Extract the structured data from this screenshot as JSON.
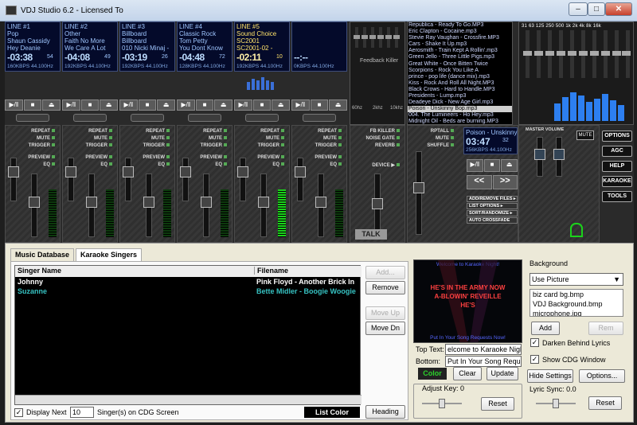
{
  "window": {
    "title": "VDJ Studio 6.2 - Licensed To",
    "btn_min": "–",
    "btn_max": "□",
    "btn_close": "✕"
  },
  "decks": [
    {
      "line": "LINE #1",
      "genre": "Pop",
      "artist": "Shaun Cassidy",
      "title": "Hey Deanie",
      "time": "-03:38",
      "sub": "54",
      "kbps": "160KBPS 44.100Hz"
    },
    {
      "line": "LINE #2",
      "genre": "Other",
      "artist": "Faith No More",
      "title": "We Care A Lot",
      "time": "-04:08",
      "sub": "49",
      "kbps": "192KBPS 44.100Hz"
    },
    {
      "line": "LINE #3",
      "genre": "Billboard",
      "artist": "Billboard",
      "title": "010 Nicki Minaj -",
      "time": "-03:19",
      "sub": "26",
      "kbps": "192KBPS 44.100Hz"
    },
    {
      "line": "LINE #4",
      "genre": "Classic Rock",
      "artist": "Tom Petty",
      "title": "You Dont Know",
      "time": "-04:48",
      "sub": "72",
      "kbps": "128KBPS 44.100Hz"
    },
    {
      "line": "LINE #5",
      "genre": "Sound Choice",
      "artist": "SC2001",
      "title": "SC2001-02 -",
      "time": "-02:11",
      "sub": "10",
      "kbps": "192KBPS 44.100Hz"
    },
    {
      "line": "",
      "genre": "",
      "artist": "",
      "title": "",
      "time": "--:--",
      "sub": "",
      "kbps": "0KBPS 44.100Hz"
    }
  ],
  "strip_labels": {
    "repeat": "REPEAT",
    "mute": "MUTE",
    "trigger": "TRIGGER",
    "preview": "PREVIEW",
    "eq": "EQ"
  },
  "transport": {
    "play": "▶/‖",
    "stop": "■",
    "eject": "⏏"
  },
  "feedback": {
    "title": "Feedback Killer",
    "f1": "60hz",
    "f2": "2khz",
    "f3": "10khz"
  },
  "talk": {
    "label": "TALK",
    "fb_killer": "FB KILLER",
    "noise_gate": "NOISE GATE",
    "reverb": "REVERB",
    "device": "DEVICE ▶"
  },
  "playlist": [
    "Republica - Ready To Go.MP3",
    "Eric Clapton - Cocaine.mp3",
    "Stevie Ray Vaughan - Crossfire.MP3",
    "Cars - Shake It Up.mp3",
    "Aerosmith - Train Kept A Rollin'.mp3",
    "Green Jello - Three Little Pigs.mp3",
    "Great White - Once Bitten Twice",
    "Scorpions - Rock You Like A",
    "prince - pop life (dance mix).mp3",
    "Kiss - Rock And Roll All Night.MP3",
    "Black Crows - Hard to Handle.MP3",
    "Presidents - Lump.mp3",
    "Deadeye Dick - New Age Girl.mp3",
    "Poison - Unskinny Bop.mp3",
    "004. The Lumineers - Ho Hey.mp3",
    "Midnight Oil - Beds are burning.MP3"
  ],
  "playlist_selected": 13,
  "playlist_deck": {
    "name": "Poison - Unskinny",
    "time": "03:47",
    "sub": "32",
    "kbps": "256KBPS 44.100Hz",
    "rptall": "RPTALL",
    "mute": "MUTE",
    "shuffle": "SHUFFLE",
    "rew": "<<",
    "fwd": ">>",
    "menu1": "ADD/REMOVE FILES ▸",
    "menu2": "LIST OPTIONS ▸",
    "menu3": "SORT/RANDOMIZE ▸",
    "menu4": "AUTO CROSSFADE"
  },
  "eq": {
    "bands": "31  63  125 250 500  1k  2k  4k  8k  16k"
  },
  "master": {
    "label": "MASTER VOLUME",
    "mute": "MUTE"
  },
  "side_buttons": [
    "OPTIONS",
    "AGC",
    "HELP",
    "KARAOKE",
    "TOOLS"
  ],
  "lower": {
    "tab1": "Music Database",
    "tab2": "Karaoke Singers",
    "col_singer": "Singer Name",
    "col_file": "Filename",
    "rows": [
      {
        "singer": "Johnny",
        "file": "Pink Floyd - Another Brick In"
      },
      {
        "singer": "Suzanne",
        "file": "Bette Midler - Boogie Woogie"
      }
    ],
    "add": "Add...",
    "remove": "Remove",
    "move_up": "Move Up",
    "move_dn": "Move Dn",
    "display_next": "Display Next",
    "display_count": "10",
    "singers_label": "Singer(s) on CDG Screen",
    "list_color": "List Color",
    "heading": "Heading"
  },
  "karaoke": {
    "preview_top": "Welcome to Karaoke Night!",
    "preview_l1": "HE'S IN THE ARMY NOW",
    "preview_l2": "A-BLOWIN' REVEILLE",
    "preview_l3": "HE'S",
    "preview_bottom": "Put In Your Song Requests Now!",
    "top_text_label": "Top Text:",
    "top_text": "elcome to Karaoke Night!",
    "bottom_label": "Bottom:",
    "bottom_text": "Put In Your Song Reque",
    "color": "Color",
    "clear": "Clear",
    "update": "Update",
    "adjust_key": "Adjust Key: 0",
    "reset": "Reset",
    "background_label": "Background",
    "bg_select": "Use Picture",
    "bg_files": [
      "biz card bg.bmp",
      "VDJ Background.bmp",
      "microphone.jpg"
    ],
    "add": "Add",
    "rem": "Rem",
    "darken": "Darken Behind Lyrics",
    "show_cdg": "Show CDG Window",
    "hide_settings": "Hide Settings",
    "options": "Options...",
    "lyric_sync": "Lyric Sync: 0.0",
    "reset2": "Reset"
  },
  "colors": {
    "lcd_bg": "#040a2a",
    "lcd_text": "#9fc6ff",
    "vu_green": "#1bd31b",
    "singer2": "#36c2c2"
  }
}
